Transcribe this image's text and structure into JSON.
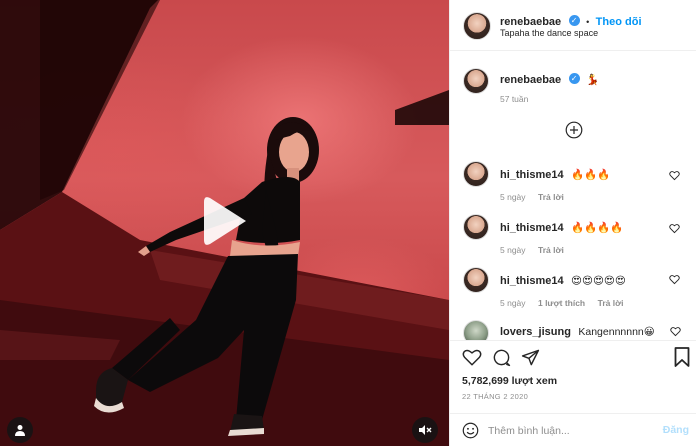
{
  "header": {
    "username": "renebaebae",
    "follow_label": "Theo dõi",
    "separator": "•",
    "location": "Tapaha the dance space"
  },
  "caption": {
    "username": "renebaebae",
    "emoji": "💃",
    "time": "57 tuần"
  },
  "load_more_icon": "plus-circle-icon",
  "comments": [
    {
      "username": "hi_thisme14",
      "text": "🔥🔥🔥",
      "time": "5 ngày",
      "reply": "Trả lời",
      "likes": ""
    },
    {
      "username": "hi_thisme14",
      "text": "🔥🔥🔥🔥",
      "time": "5 ngày",
      "reply": "Trả lời",
      "likes": ""
    },
    {
      "username": "hi_thisme14",
      "text": "😍😍😍😍😍",
      "time": "5 ngày",
      "reply": "Trả lời",
      "likes": "1 lượt thích"
    },
    {
      "username": "lovers_jisung",
      "text": "Kangennnnnn😀",
      "time": "",
      "reply": "",
      "likes": ""
    }
  ],
  "actions": {
    "views": "5,782,699 lượt xem",
    "date": "22 THÁNG 2 2020"
  },
  "add_comment": {
    "placeholder": "Thêm bình luận...",
    "post_label": "Đăng"
  },
  "colors": {
    "accent": "#0095f6",
    "verified": "#3897f0",
    "wall": "#d75a5c"
  }
}
